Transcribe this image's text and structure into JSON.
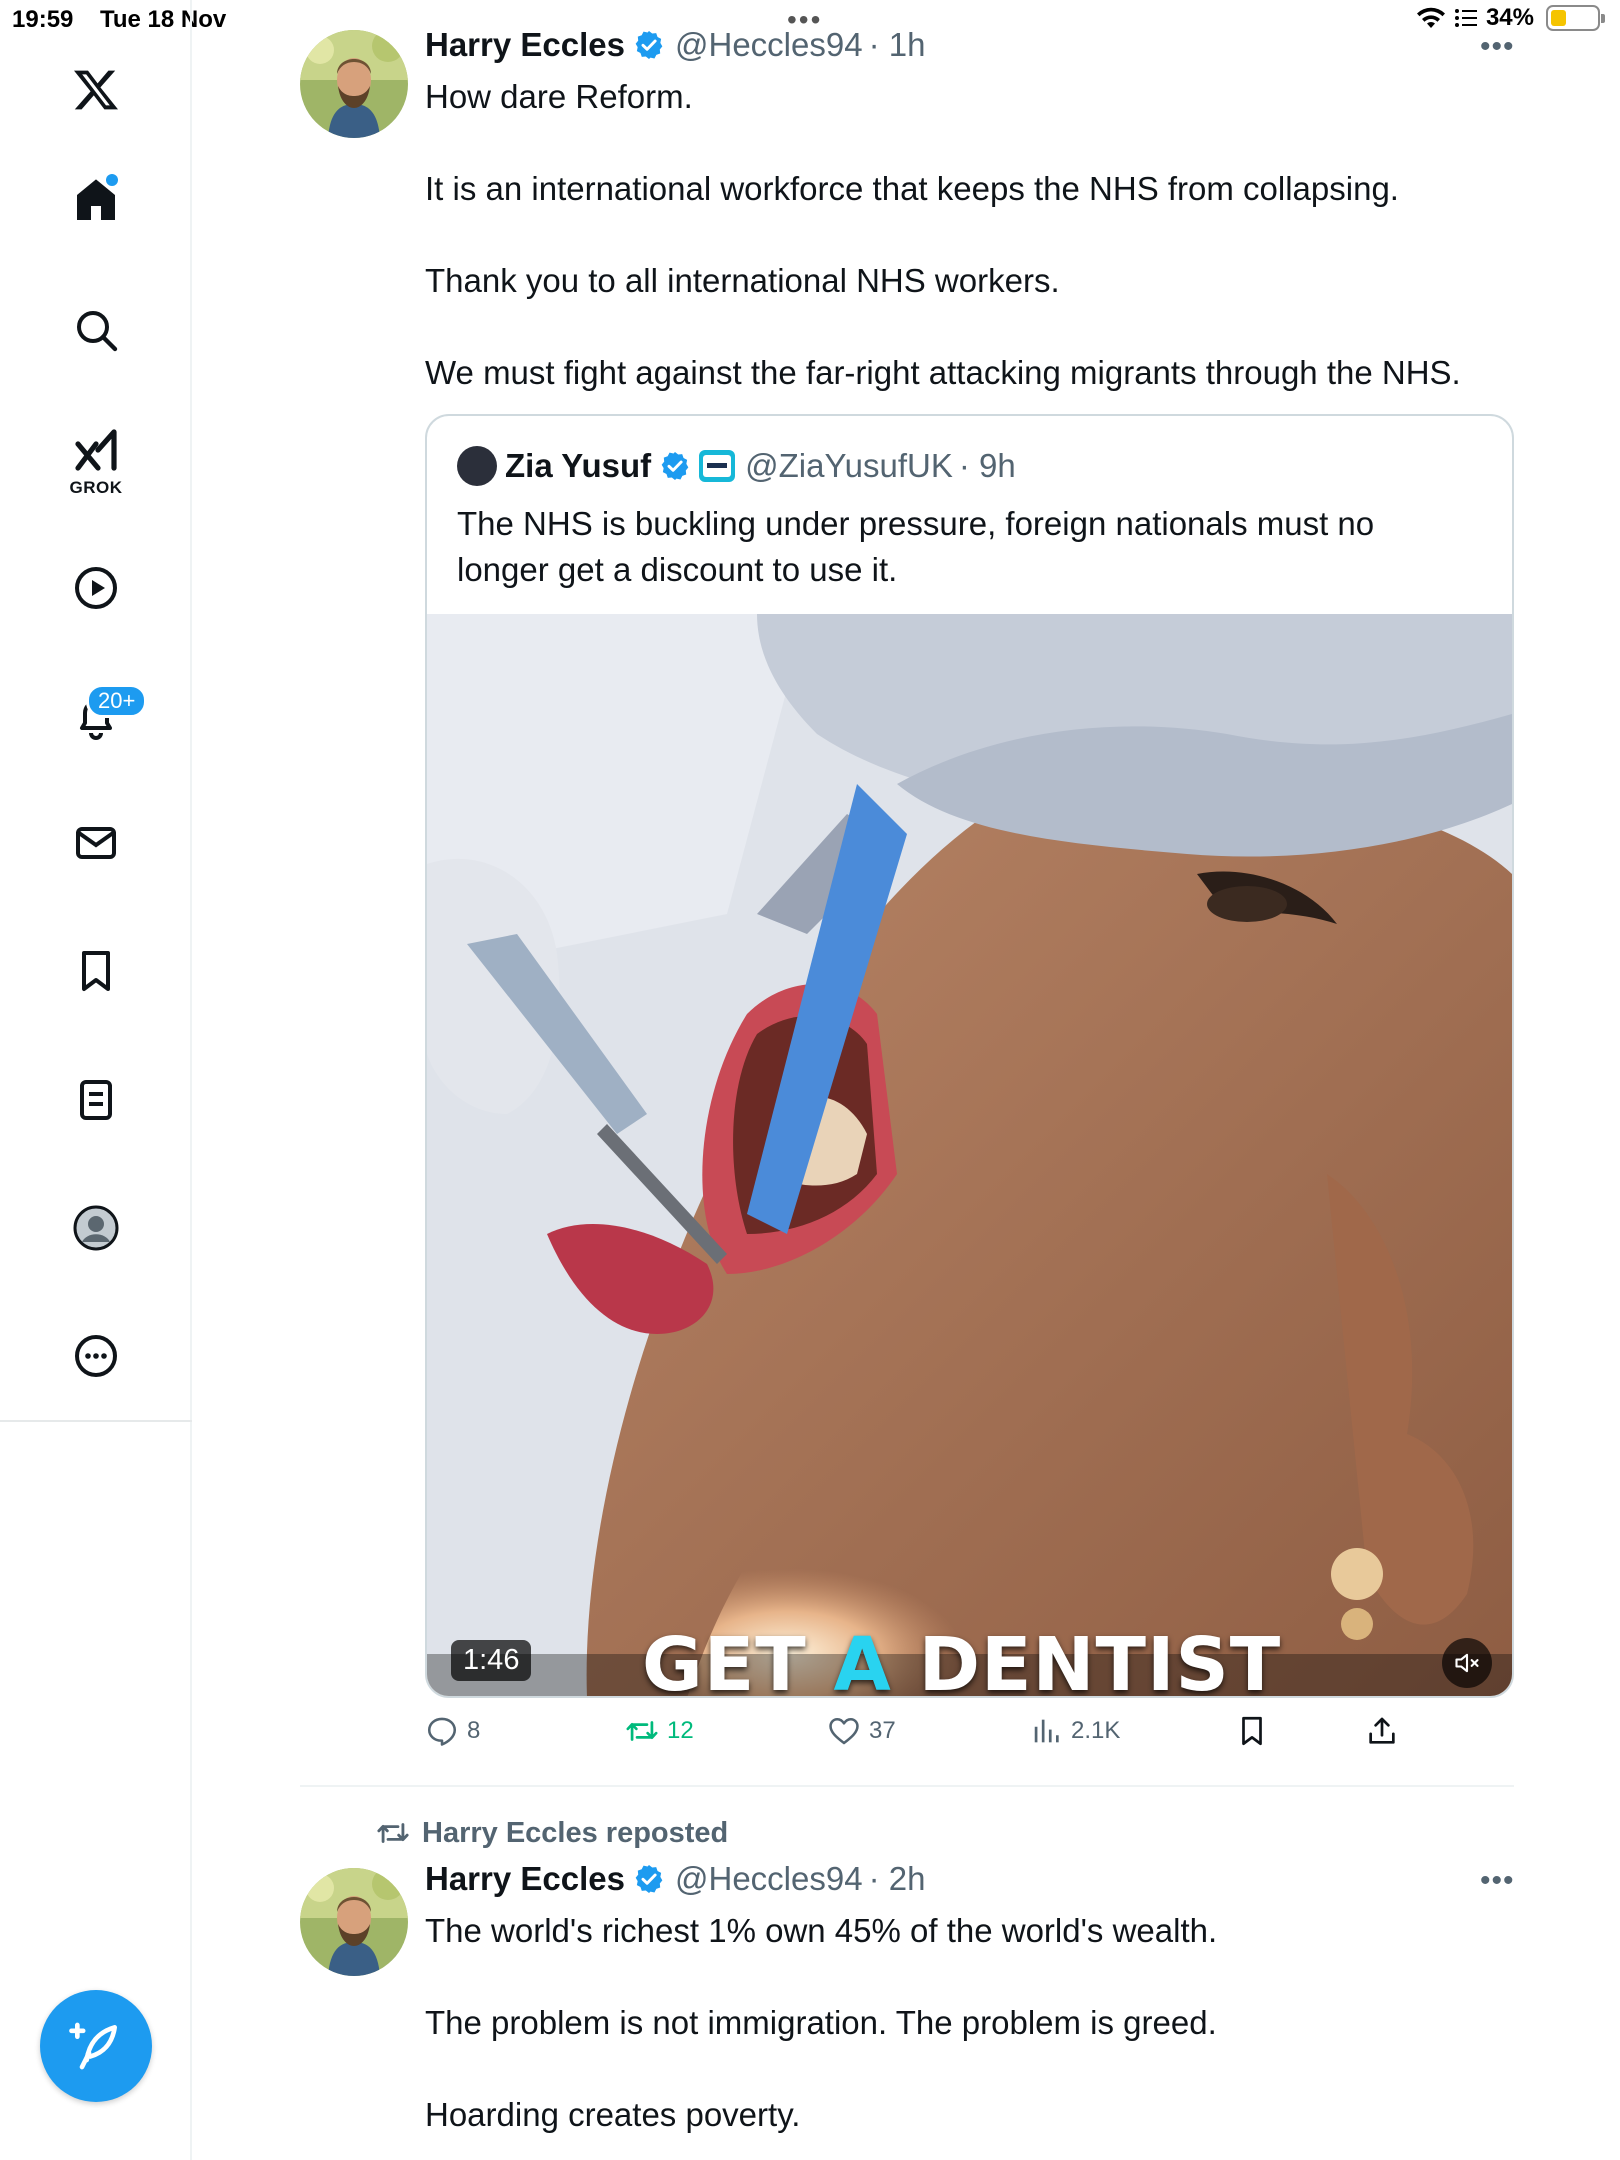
{
  "status_bar": {
    "time": "19:59",
    "date": "Tue 18 Nov",
    "battery": "34%",
    "battery_level": 0.34
  },
  "sidebar": {
    "items": [
      {
        "name": "x-logo-icon"
      },
      {
        "name": "home-icon"
      },
      {
        "name": "search-icon"
      },
      {
        "name": "grok-icon",
        "label": "GROK"
      },
      {
        "name": "video-icon"
      },
      {
        "name": "notifications-icon",
        "badge": "20+"
      },
      {
        "name": "messages-icon"
      },
      {
        "name": "bookmarks-icon"
      },
      {
        "name": "lists-icon"
      },
      {
        "name": "profile-icon"
      },
      {
        "name": "more-icon"
      }
    ],
    "accent": "#1d9bf0"
  },
  "tweet1": {
    "author": "Harry Eccles",
    "handle": "@Heccles94",
    "time": "· 1h",
    "lines": [
      "How dare Reform.",
      "It is an international workforce that keeps the NHS from collapsing.",
      "Thank you to all international NHS workers.",
      "We must fight against the far-right attacking migrants through the NHS."
    ],
    "quote": {
      "author": "Zia Yusuf",
      "handle": "@ZiaYusufUK",
      "time": "· 9h",
      "text_lines": [
        "The NHS is buckling under pressure, foreign nationals must no",
        "longer get a discount to use it."
      ],
      "video": {
        "duration": "1:46",
        "caption_pre": "GET ",
        "caption_highlight": "A",
        "caption_post": " DENTIST"
      }
    },
    "stats": {
      "replies": "8",
      "reposts": "12",
      "likes": "37",
      "views": "2.1K"
    }
  },
  "tweet2": {
    "repost_label": "Harry Eccles reposted",
    "author": "Harry Eccles",
    "handle": "@Heccles94",
    "time": "· 2h",
    "lines": [
      "The world's richest 1% own 45% of the world's wealth.",
      "The problem is not immigration. The problem is greed.",
      "Hoarding creates poverty."
    ]
  }
}
